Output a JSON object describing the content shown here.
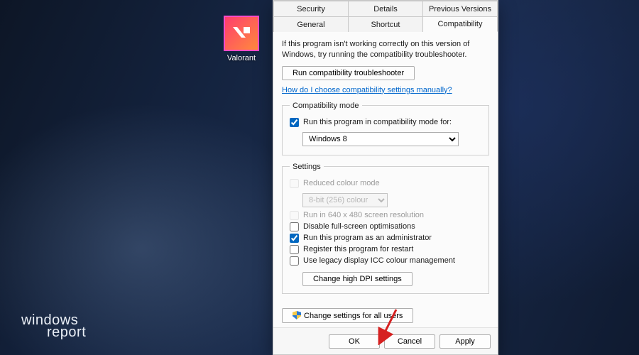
{
  "desktop": {
    "shortcut_label": "Valorant"
  },
  "watermark": {
    "line1": "windows",
    "line2": "report"
  },
  "dialog": {
    "tabs_row1": [
      "Security",
      "Details",
      "Previous Versions"
    ],
    "tabs_row2": [
      "General",
      "Shortcut",
      "Compatibility"
    ],
    "active_tab": "Compatibility",
    "intro": "If this program isn't working correctly on this version of Windows, try running the compatibility troubleshooter.",
    "troubleshooter_btn": "Run compatibility troubleshooter",
    "manual_link": "How do I choose compatibility settings manually?",
    "compat_mode": {
      "legend": "Compatibility mode",
      "checkbox_label": "Run this program in compatibility mode for:",
      "checked": true,
      "selected": "Windows 8"
    },
    "settings": {
      "legend": "Settings",
      "reduced_colour": {
        "label": "Reduced colour mode",
        "checked": false,
        "enabled": false
      },
      "colour_depth": "8-bit (256) colour",
      "low_res": {
        "label": "Run in 640 x 480 screen resolution",
        "checked": false,
        "enabled": false
      },
      "disable_fullscreen": {
        "label": "Disable full-screen optimisations",
        "checked": false
      },
      "run_admin": {
        "label": "Run this program as an administrator",
        "checked": true
      },
      "register_restart": {
        "label": "Register this program for restart",
        "checked": false
      },
      "legacy_icc": {
        "label": "Use legacy display ICC colour management",
        "checked": false
      },
      "dpi_btn": "Change high DPI settings"
    },
    "all_users_btn": "Change settings for all users",
    "footer": {
      "ok": "OK",
      "cancel": "Cancel",
      "apply": "Apply"
    }
  }
}
